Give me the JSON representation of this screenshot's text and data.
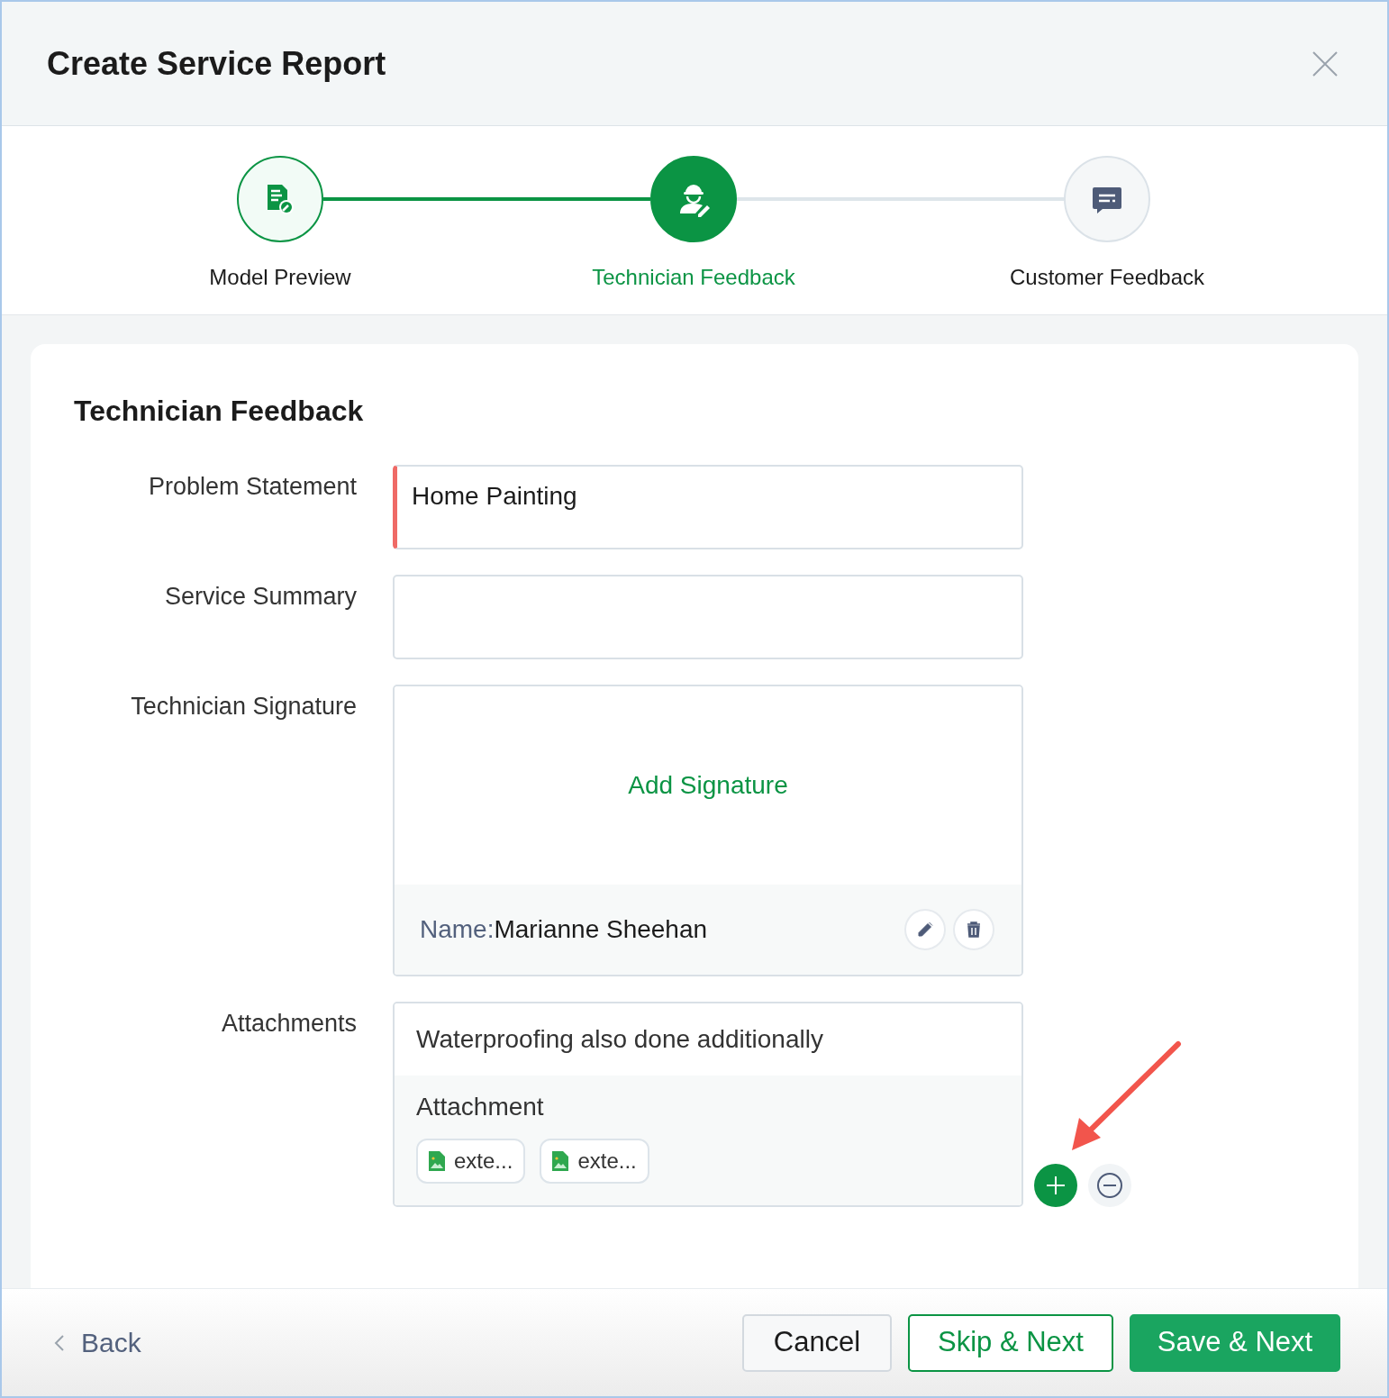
{
  "window": {
    "title": "Create Service Report"
  },
  "steps": [
    {
      "label": "Model Preview",
      "done": true,
      "selected": false
    },
    {
      "label": "Technician Feedback",
      "done": false,
      "selected": true
    },
    {
      "label": "Customer Feedback",
      "done": false,
      "selected": false
    }
  ],
  "section": {
    "title": "Technician Feedback"
  },
  "fields": [
    {
      "kind": "text",
      "label": "Problem Statement",
      "value": "Home Painting",
      "required": true
    },
    {
      "kind": "text",
      "label": "Service Summary",
      "required": false
    },
    {
      "kind": "signature",
      "label": "Technician Signature",
      "action": "Add Signature",
      "name_label": "Name:",
      "name_value": "Marianne Sheehan"
    },
    {
      "kind": "attachments",
      "label": "Attachments",
      "note": "Waterproofing also done additionally",
      "heading": "Attachment",
      "files": [
        {
          "name": "exte..."
        },
        {
          "name": "exte..."
        }
      ]
    }
  ],
  "footer": {
    "back": "Back",
    "buttons": [
      {
        "kind": "secondary",
        "label": "Cancel"
      },
      {
        "kind": "outline",
        "label": "Skip & Next"
      },
      {
        "kind": "primary",
        "label": "Save & Next"
      }
    ]
  }
}
